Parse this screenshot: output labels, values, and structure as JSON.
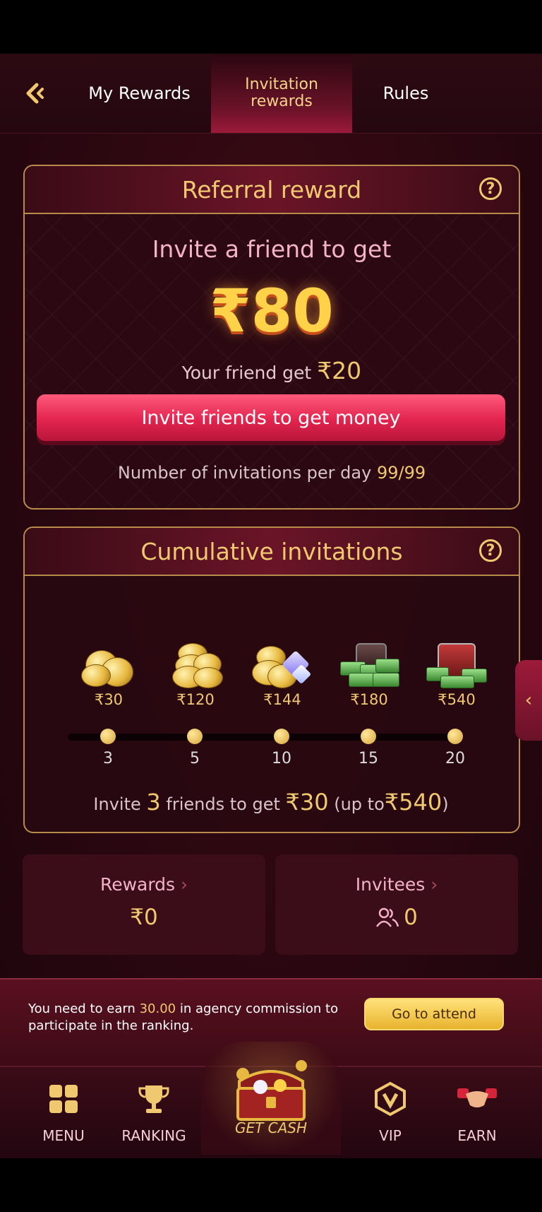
{
  "header": {
    "tabs": [
      {
        "label": "My Rewards"
      },
      {
        "label": "Invitation rewards"
      },
      {
        "label": "Rules"
      }
    ]
  },
  "referral": {
    "title": "Referral reward",
    "invite_text": "Invite a friend to get",
    "amount": "₹80",
    "friend_text": "Your friend get",
    "friend_amount": "₹20",
    "button": "Invite friends to get money",
    "per_day_label": "Number of invitations per day",
    "per_day_value": "99/99"
  },
  "cumulative": {
    "title": "Cumulative invitations",
    "milestones": [
      {
        "reward": "₹30",
        "count": "3",
        "icon": "coin-stack-small-icon"
      },
      {
        "reward": "₹120",
        "count": "5",
        "icon": "coin-stack-icon"
      },
      {
        "reward": "₹144",
        "count": "10",
        "icon": "coins-gems-icon"
      },
      {
        "reward": "₹180",
        "count": "15",
        "icon": "cash-pile-icon"
      },
      {
        "reward": "₹540",
        "count": "20",
        "icon": "treasure-chest-icon"
      }
    ],
    "footer": {
      "pre": "Invite",
      "n": "3",
      "mid": "friends to get",
      "amount": "₹30",
      "up_pre": "(up to",
      "up_amount": "₹540",
      "up_post": ")"
    }
  },
  "stats": {
    "rewards_label": "Rewards",
    "rewards_value": "₹0",
    "invitees_label": "Invitees",
    "invitees_value": "0"
  },
  "ranking_banner": {
    "text_pre": "You need to earn",
    "text_amount": "30.00",
    "text_post": "in agency commission to participate in the ranking.",
    "button": "Go to attend"
  },
  "nav": {
    "menu": "MENU",
    "ranking": "RANKING",
    "get_cash": "GET CASH",
    "vip": "VIP",
    "earn": "EARN"
  },
  "colors": {
    "accent_gold": "#f0c870",
    "button_red": "#e3244f",
    "background": "#2a0710"
  }
}
